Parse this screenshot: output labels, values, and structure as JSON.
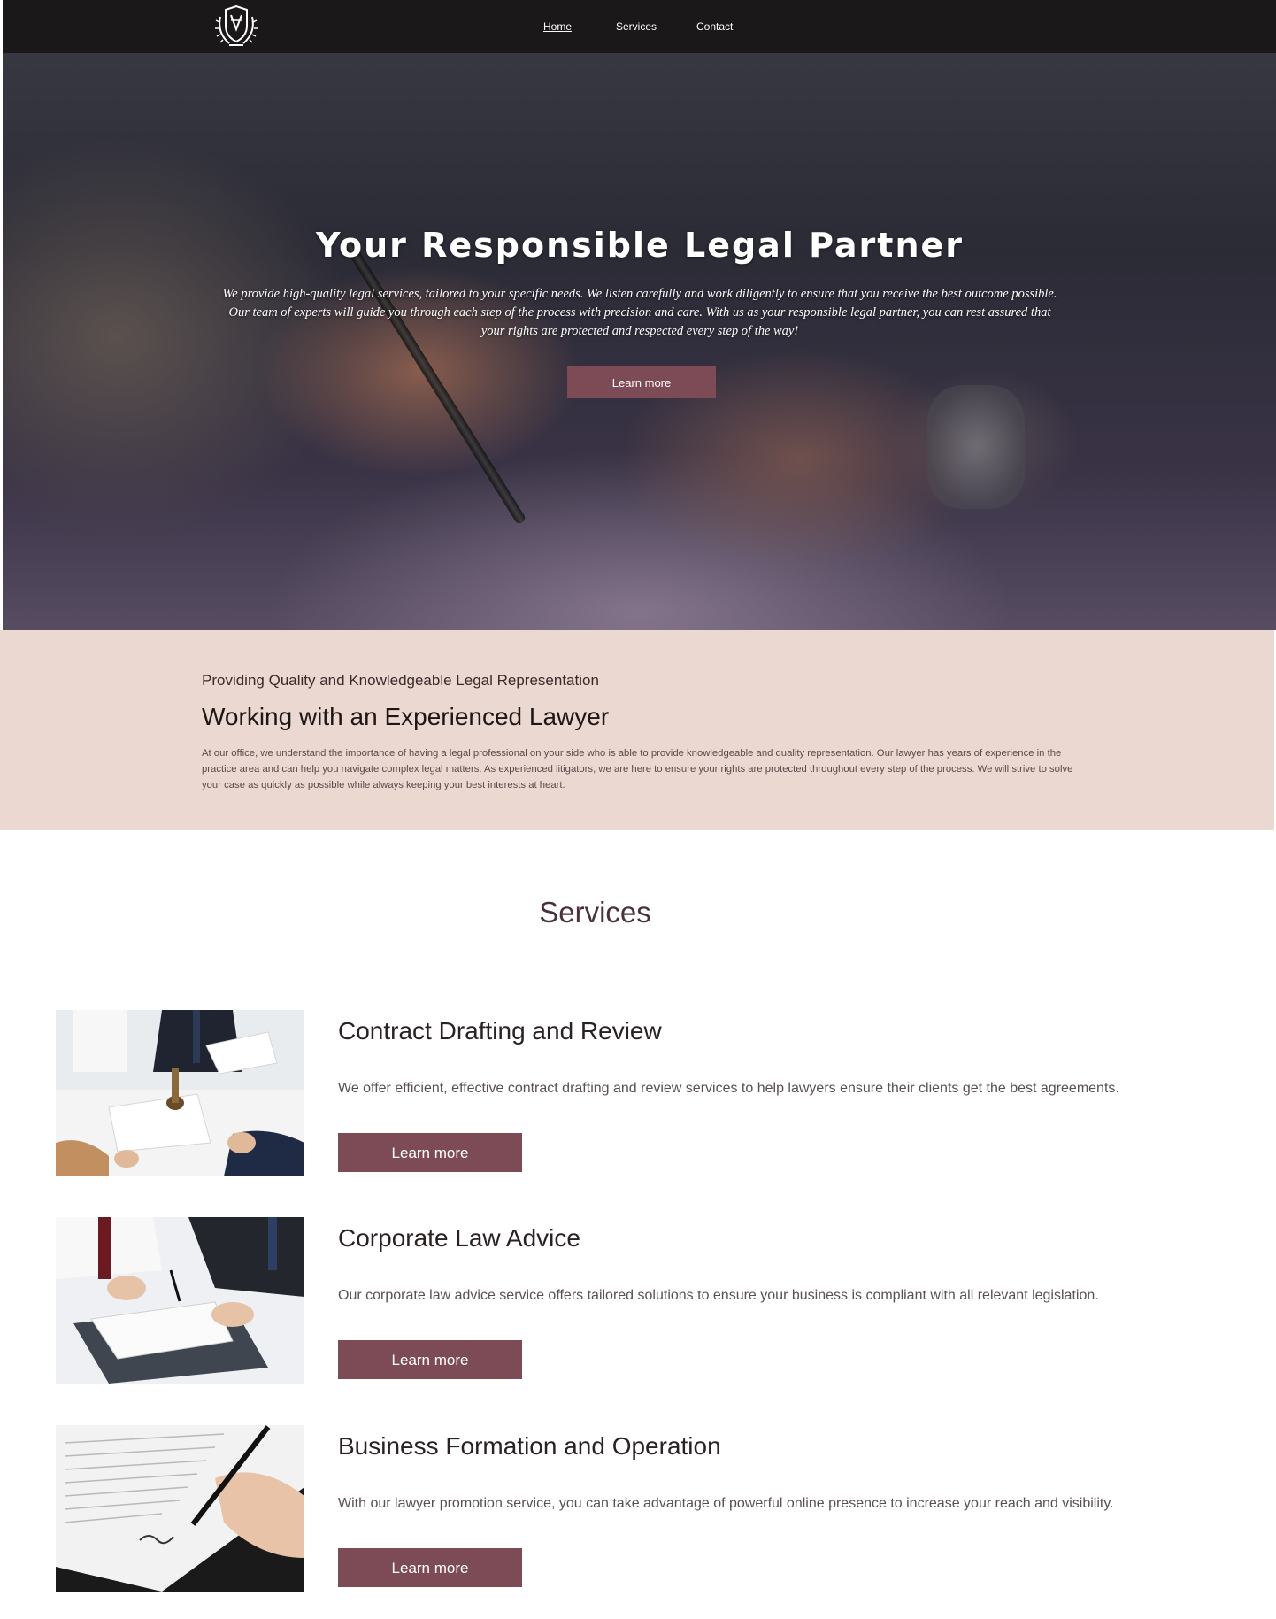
{
  "nav": {
    "links": [
      "Home",
      "Services",
      "Contact"
    ]
  },
  "hero": {
    "title": "Your Responsible Legal Partner",
    "text": "We provide high-quality legal services, tailored to your specific needs. We listen carefully and work diligently to ensure that you receive the best outcome possible. Our team of experts will guide you through each step of the process with precision and care. With us as your responsible legal partner, you can rest assured that your rights are protected and respected every step of the way!",
    "button_label": "Learn more"
  },
  "about": {
    "kicker": "Providing Quality and Knowledgeable Legal Representation",
    "title": "Working with an Experienced Lawyer",
    "text": "At our office, we understand the importance of having a legal professional on your side who is able to provide knowledgeable and quality representation. Our lawyer has years of experience in the practice area and can help you navigate complex legal matters. As experienced litigators, we are here to ensure your rights are protected throughout every step of the process. We will strive to solve your case as quickly as possible while always keeping your best interests at heart."
  },
  "services": {
    "heading": "Services",
    "items": [
      {
        "title": "Contract Drafting and Review",
        "description": "We offer efficient, effective contract drafting and review services to help lawyers ensure their clients get the best agreements.",
        "button_label": "Learn more"
      },
      {
        "title": "Corporate Law Advice",
        "description": "Our corporate law advice service offers tailored solutions to ensure your business is compliant with all relevant legislation.",
        "button_label": "Learn more"
      },
      {
        "title": "Business Formation and Operation",
        "description": "With our lawyer promotion service, you can take advantage of powerful online presence to increase your reach and visibility.",
        "button_label": "Learn more"
      }
    ]
  },
  "colors": {
    "accent": "#7d4b56",
    "about_bg": "#ebd8d0",
    "nav_bg": "#191616"
  },
  "icons": [
    "law-firm-crest-logo-icon"
  ]
}
